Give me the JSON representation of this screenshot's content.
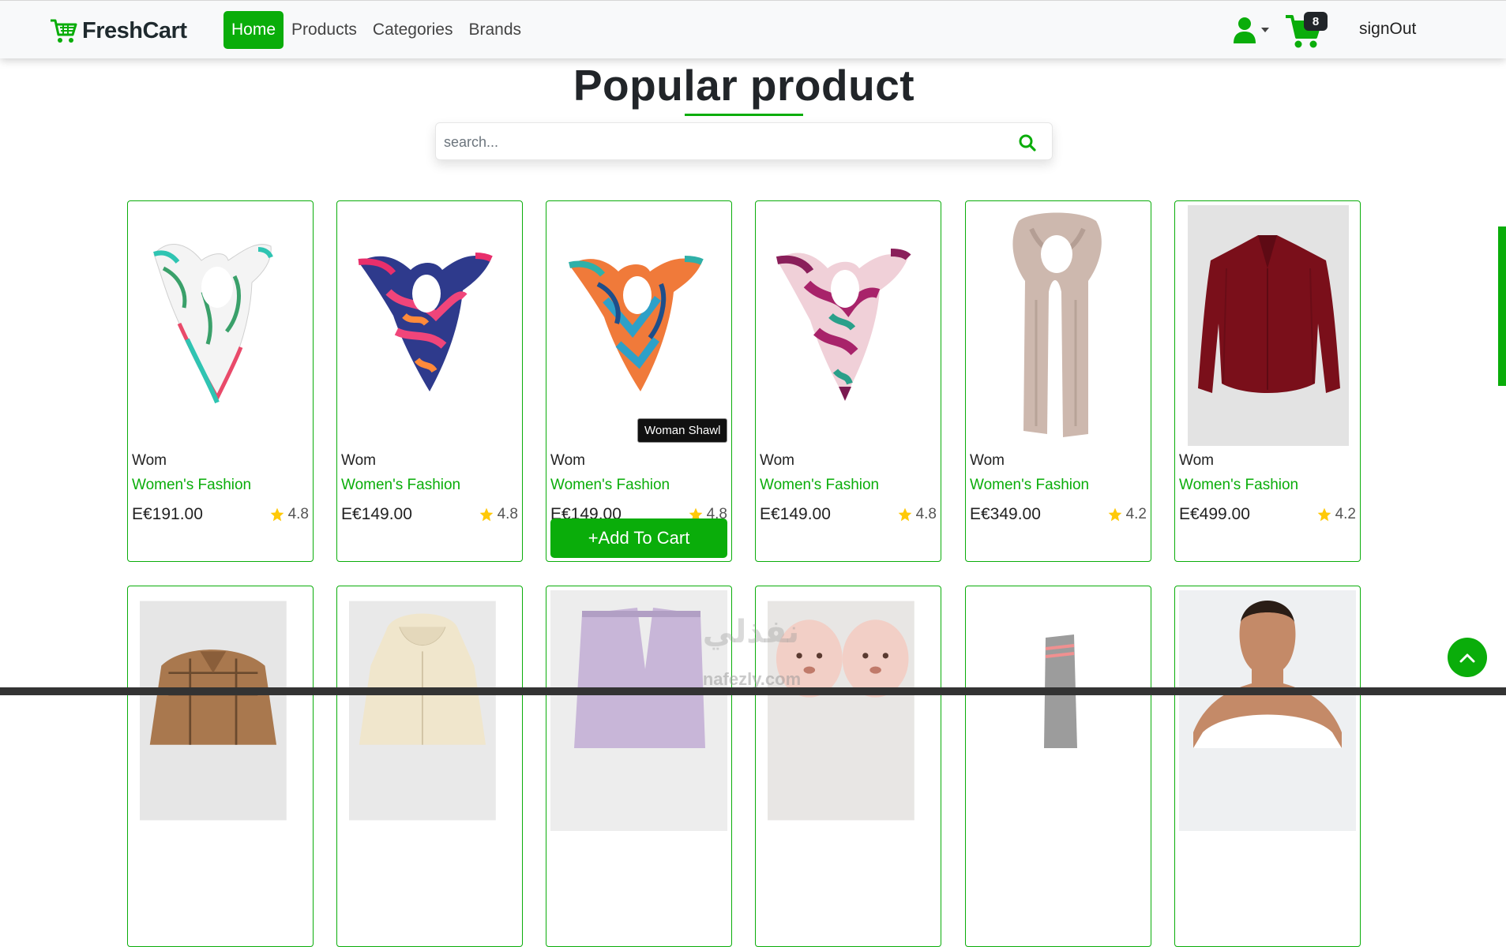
{
  "brand": {
    "name": "FreshCart"
  },
  "nav": {
    "items": [
      "Home",
      "Products",
      "Categories",
      "Brands"
    ],
    "active": "Home"
  },
  "user": {
    "cart_count": "8",
    "signout_label": "signOut"
  },
  "page": {
    "title": "Popular product"
  },
  "search": {
    "placeholder": "search..."
  },
  "products_row1": [
    {
      "name": "Wom",
      "category": "Women's Fashion",
      "price": "E€191.00",
      "rating": "4.8",
      "image": "white-teal-scarf"
    },
    {
      "name": "Wom",
      "category": "Women's Fashion",
      "price": "E€149.00",
      "rating": "4.8",
      "image": "pink-navy-scarf"
    },
    {
      "name": "Wom",
      "category": "Women's Fashion",
      "price": "E€149.00",
      "rating": "4.8",
      "image": "orange-blue-scarf",
      "tooltip": "Woman Shawl",
      "add_to_cart": "+Add To Cart"
    },
    {
      "name": "Wom",
      "category": "Women's Fashion",
      "price": "E€149.00",
      "rating": "4.8",
      "image": "burgundy-scarf"
    },
    {
      "name": "Wom",
      "category": "Women's Fashion",
      "price": "E€349.00",
      "rating": "4.2",
      "image": "beige-long-scarf"
    },
    {
      "name": "Wom",
      "category": "Women's Fashion",
      "price": "E€499.00",
      "rating": "4.2",
      "image": "burgundy-shirt"
    }
  ],
  "products_row2": [
    {
      "image": "plaid-shirt"
    },
    {
      "image": "cream-hoodie"
    },
    {
      "image": "lavender-sweatpants"
    },
    {
      "image": "bear-slippers"
    },
    {
      "image": "grey-socks"
    },
    {
      "image": "man-portrait"
    }
  ],
  "watermark": {
    "text": "نفذلي",
    "url": "nafezly.com"
  },
  "colors": {
    "accent": "#0aad0a",
    "dark": "#212529",
    "star": "#ffc908"
  }
}
